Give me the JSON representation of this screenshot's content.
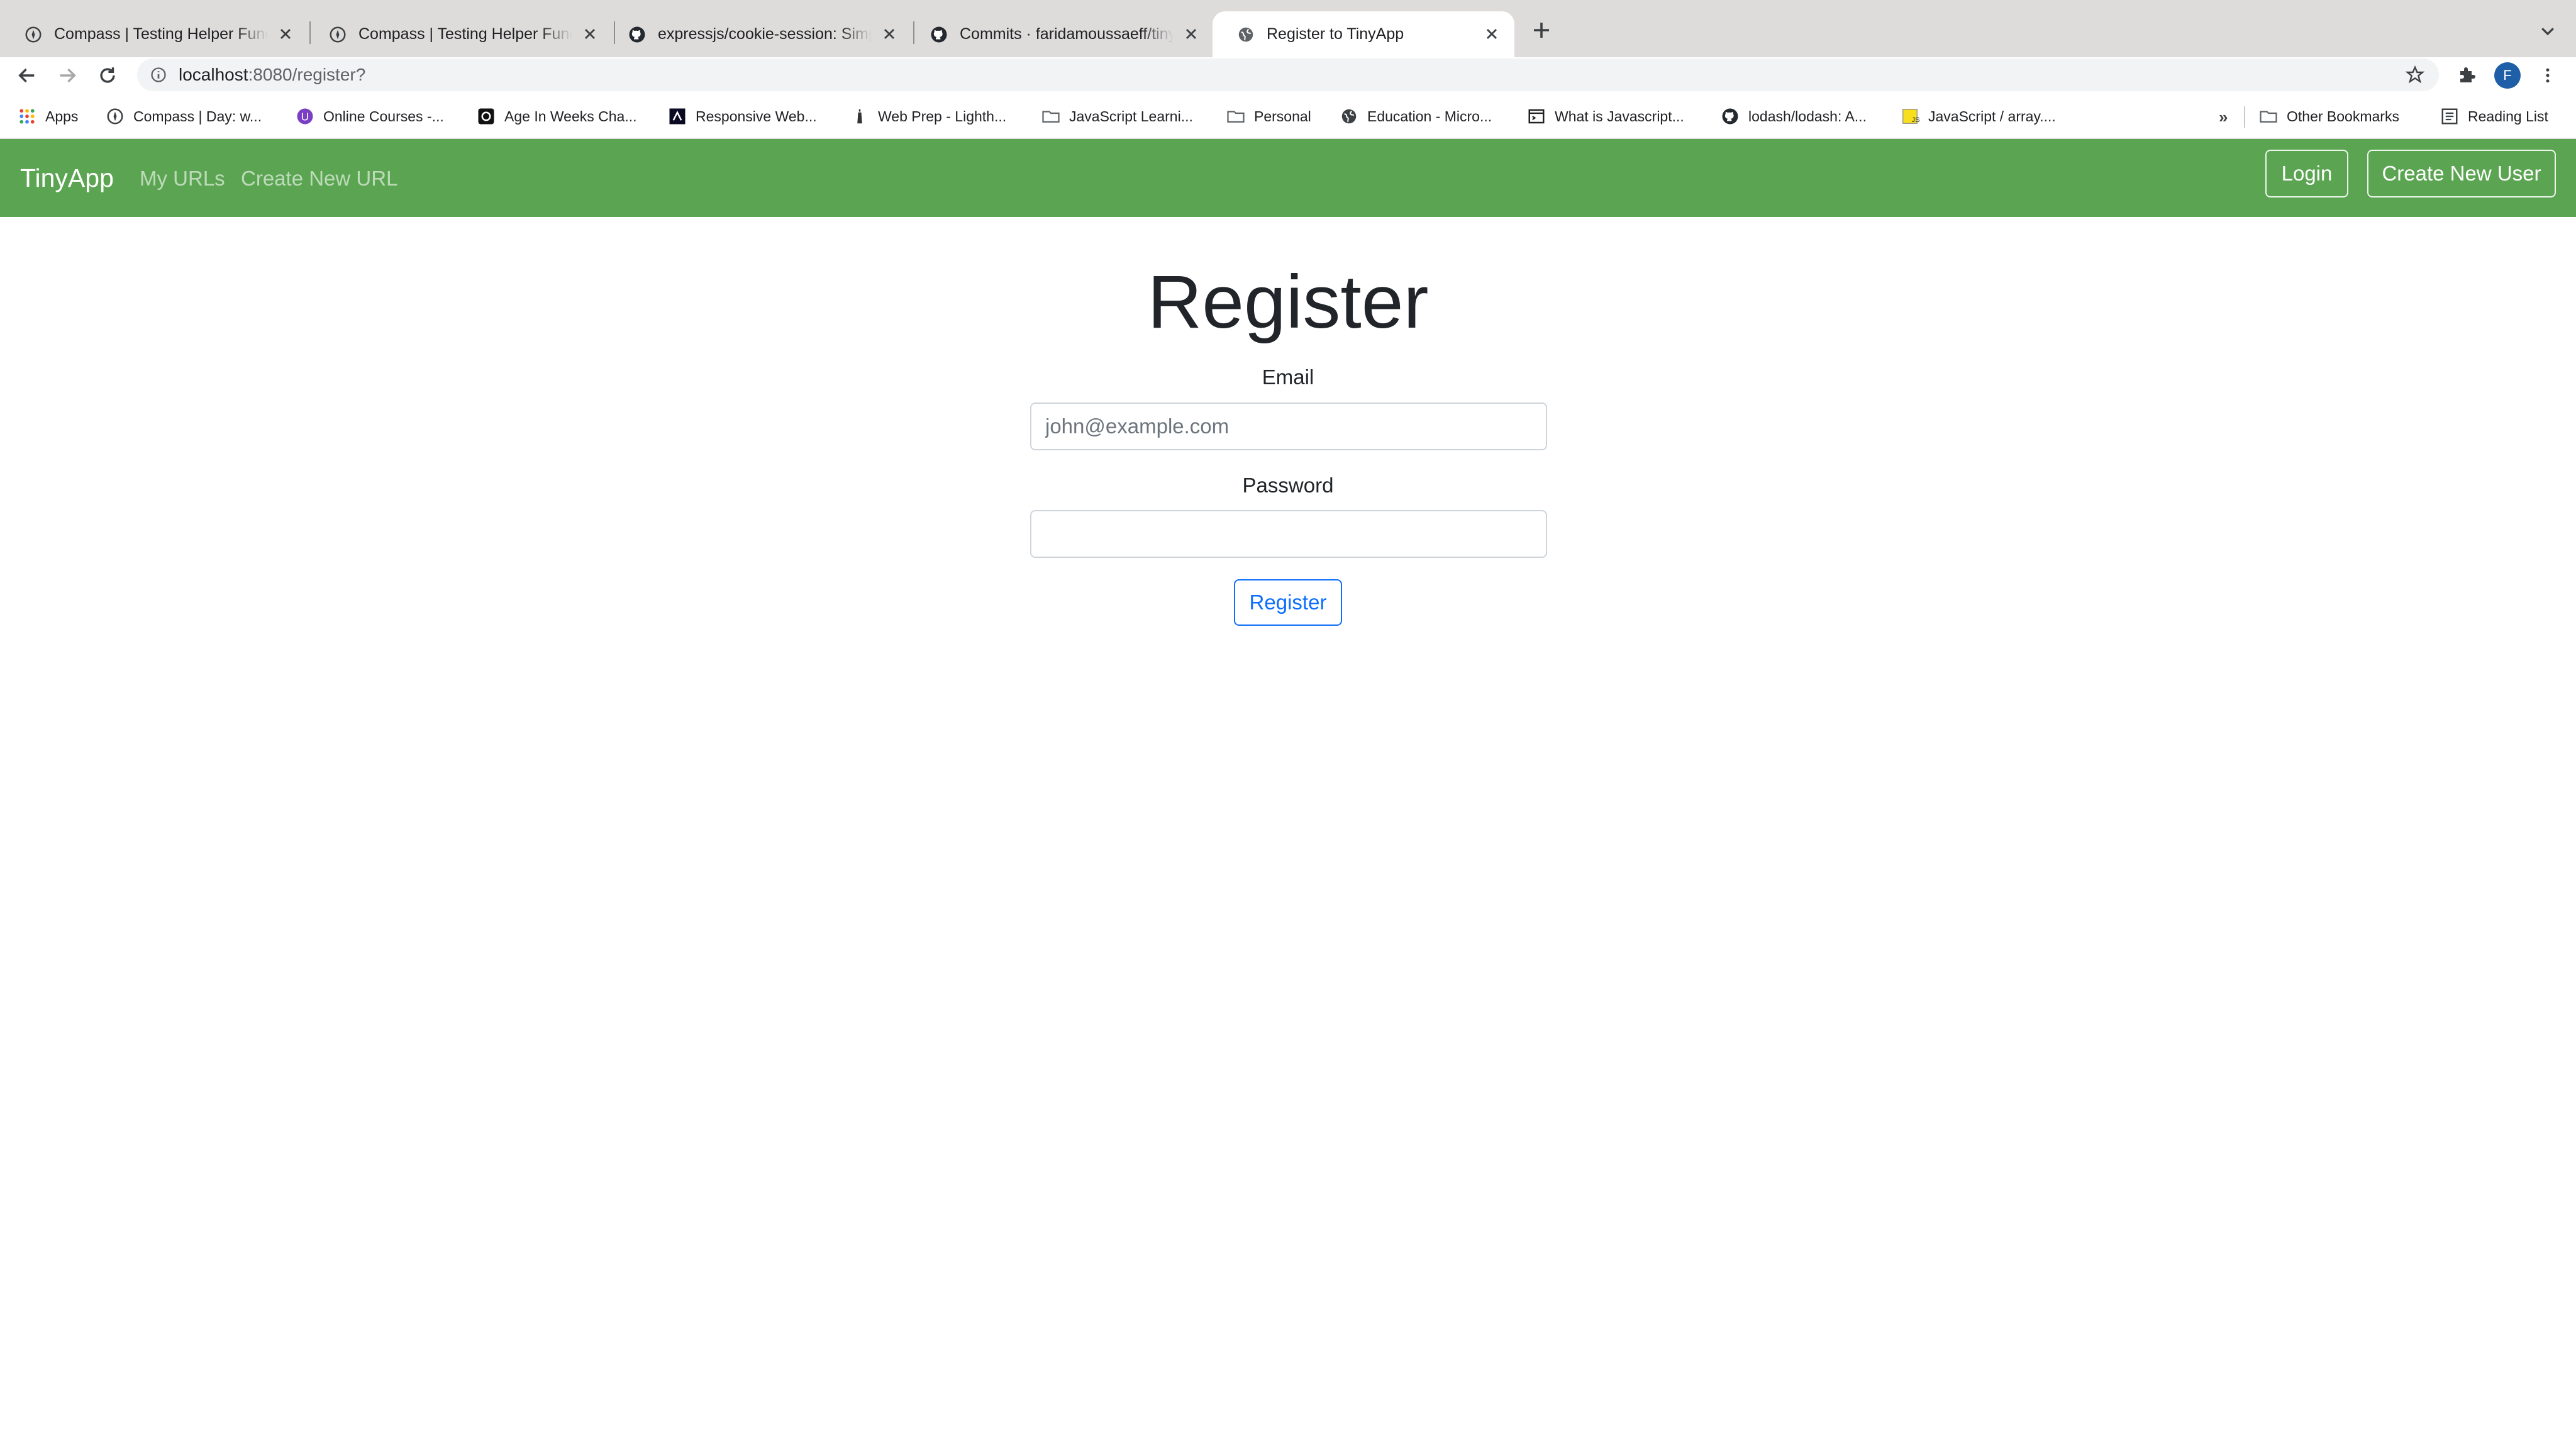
{
  "browser": {
    "tabs": [
      {
        "title": "Compass | Testing Helper Func",
        "icon": "compass-icon",
        "active": false
      },
      {
        "title": "Compass | Testing Helper Func",
        "icon": "compass-icon",
        "active": false
      },
      {
        "title": "expressjs/cookie-session: Simp",
        "icon": "github-icon",
        "active": false
      },
      {
        "title": "Commits · faridamoussaeff/tiny",
        "icon": "github-icon",
        "active": false
      },
      {
        "title": "Register to TinyApp",
        "icon": "globe-icon",
        "active": true
      }
    ],
    "address_bar": {
      "host": "localhost",
      "path": ":8080/register?"
    },
    "profile_initial": "F",
    "bookmarks": [
      {
        "label": "Apps",
        "icon": "apps-grid-icon"
      },
      {
        "label": "Compass | Day: w...",
        "icon": "compass-icon"
      },
      {
        "label": "Online Courses -...",
        "icon": "online-courses-icon"
      },
      {
        "label": "Age In Weeks Cha...",
        "icon": "codepen-icon"
      },
      {
        "label": "Responsive Web...",
        "icon": "freecodecamp-icon"
      },
      {
        "label": "Web Prep - Lighth...",
        "icon": "lighthouse-icon"
      },
      {
        "label": "JavaScript Learni...",
        "icon": "folder-icon"
      },
      {
        "label": "Personal",
        "icon": "folder-icon"
      },
      {
        "label": "Education - Micro...",
        "icon": "globe-icon"
      },
      {
        "label": "What is Javascript...",
        "icon": "terminal-icon"
      },
      {
        "label": "lodash/lodash: A...",
        "icon": "github-icon"
      },
      {
        "label": "JavaScript / array....",
        "icon": "js-icon"
      }
    ],
    "bookmarks_overflow": "»",
    "other_bookmarks": "Other Bookmarks",
    "reading_list": "Reading List"
  },
  "app": {
    "brand": "TinyApp",
    "nav_links": [
      "My URLs",
      "Create New URL"
    ],
    "login_button": "Login",
    "create_user_button": "Create New User"
  },
  "form": {
    "heading": "Register",
    "email_label": "Email",
    "email_placeholder": "john@example.com",
    "email_value": "",
    "password_label": "Password",
    "password_value": "",
    "submit_label": "Register"
  },
  "colors": {
    "navbar": "#5ba552",
    "submit_accent": "#0d6efd",
    "tabstrip": "#dedcdb"
  }
}
